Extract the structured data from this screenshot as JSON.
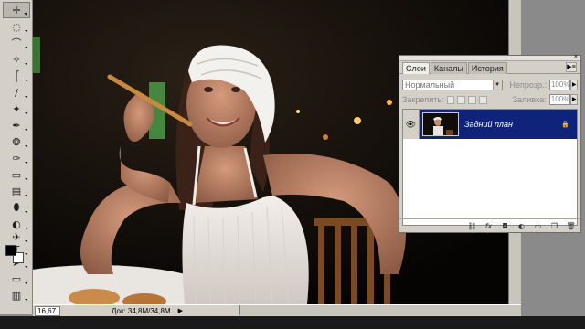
{
  "toolbox": {
    "tools": [
      {
        "name": "move-tool",
        "glyph": "✛"
      },
      {
        "name": "marquee-tool",
        "glyph": "◌"
      },
      {
        "name": "lasso-tool",
        "glyph": "⌒"
      },
      {
        "name": "magic-wand-tool",
        "glyph": "✧"
      },
      {
        "name": "crop-tool",
        "glyph": "⌠"
      },
      {
        "name": "slice-tool",
        "glyph": "∕"
      },
      {
        "name": "healing-brush-tool",
        "glyph": "✦"
      },
      {
        "name": "brush-tool",
        "glyph": "✒"
      },
      {
        "name": "clone-stamp-tool",
        "glyph": "❂"
      },
      {
        "name": "history-brush-tool",
        "glyph": "✑"
      },
      {
        "name": "eraser-tool",
        "glyph": "▭"
      },
      {
        "name": "gradient-tool",
        "glyph": "▤"
      },
      {
        "name": "blur-tool",
        "glyph": "⬮"
      },
      {
        "name": "dodge-tool",
        "glyph": "◐"
      },
      {
        "name": "pen-tool",
        "glyph": "✈"
      },
      {
        "name": "type-tool",
        "glyph": "T"
      },
      {
        "name": "path-selection-tool",
        "glyph": "➤"
      },
      {
        "name": "shape-tool",
        "glyph": "▭"
      },
      {
        "name": "notes-tool",
        "glyph": "▥"
      },
      {
        "name": "eyedropper-tool",
        "glyph": "✐"
      },
      {
        "name": "hand-tool",
        "glyph": "✋"
      }
    ],
    "foreground_color": "#000000",
    "background_color": "#ffffff"
  },
  "status": {
    "zoom": "16,67 %",
    "doc_info": "Док: 34,8M/34,8M"
  },
  "layers_panel": {
    "tabs": [
      "Слои",
      "Каналы",
      "История"
    ],
    "active_tab": "Слои",
    "blend_mode": "Нормальный",
    "opacity_label": "Непрозр.:",
    "opacity_value": "100%",
    "lock_label": "Закрепить:",
    "fill_label": "Заливка:",
    "fill_value": "100%",
    "layer_name": "Задний план",
    "footer_icons": [
      "link-icon",
      "fx-icon",
      "mask-icon",
      "adjustment-icon",
      "group-icon",
      "new-layer-icon",
      "trash-icon"
    ]
  },
  "colors": {
    "panel_bg": "#d4d0c8",
    "selected_layer": "#0f237a"
  }
}
